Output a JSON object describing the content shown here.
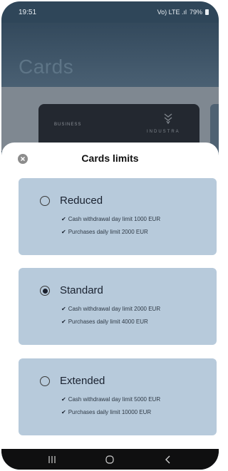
{
  "status_bar": {
    "time": "19:51",
    "battery": "79%",
    "signal_text": "Vo) LTE .ıl"
  },
  "page": {
    "title": "Cards"
  },
  "card": {
    "tier": "BUSINESS",
    "brand": "INDUSTRA"
  },
  "sheet": {
    "title": "Cards limits",
    "options": [
      {
        "name": "Reduced",
        "selected": false,
        "features": [
          "Cash withdrawal day limit 1000 EUR",
          "Purchases daily limit 2000 EUR"
        ]
      },
      {
        "name": "Standard",
        "selected": true,
        "features": [
          "Cash withdrawal day limit 2000 EUR",
          "Purchases daily limit 4000 EUR"
        ]
      },
      {
        "name": "Extended",
        "selected": false,
        "features": [
          "Cash withdrawal day limit 5000 EUR",
          "Purchases daily limit 10000 EUR"
        ]
      }
    ]
  },
  "icons": {
    "close": "close-icon",
    "check": "check-icon",
    "recents": "recents-icon",
    "home": "home-icon",
    "back": "back-icon"
  },
  "colors": {
    "header": "#2f4659",
    "option_bg": "#b7cadb",
    "sheet_bg": "#ffffff",
    "nav_bg": "#0f0f10"
  }
}
